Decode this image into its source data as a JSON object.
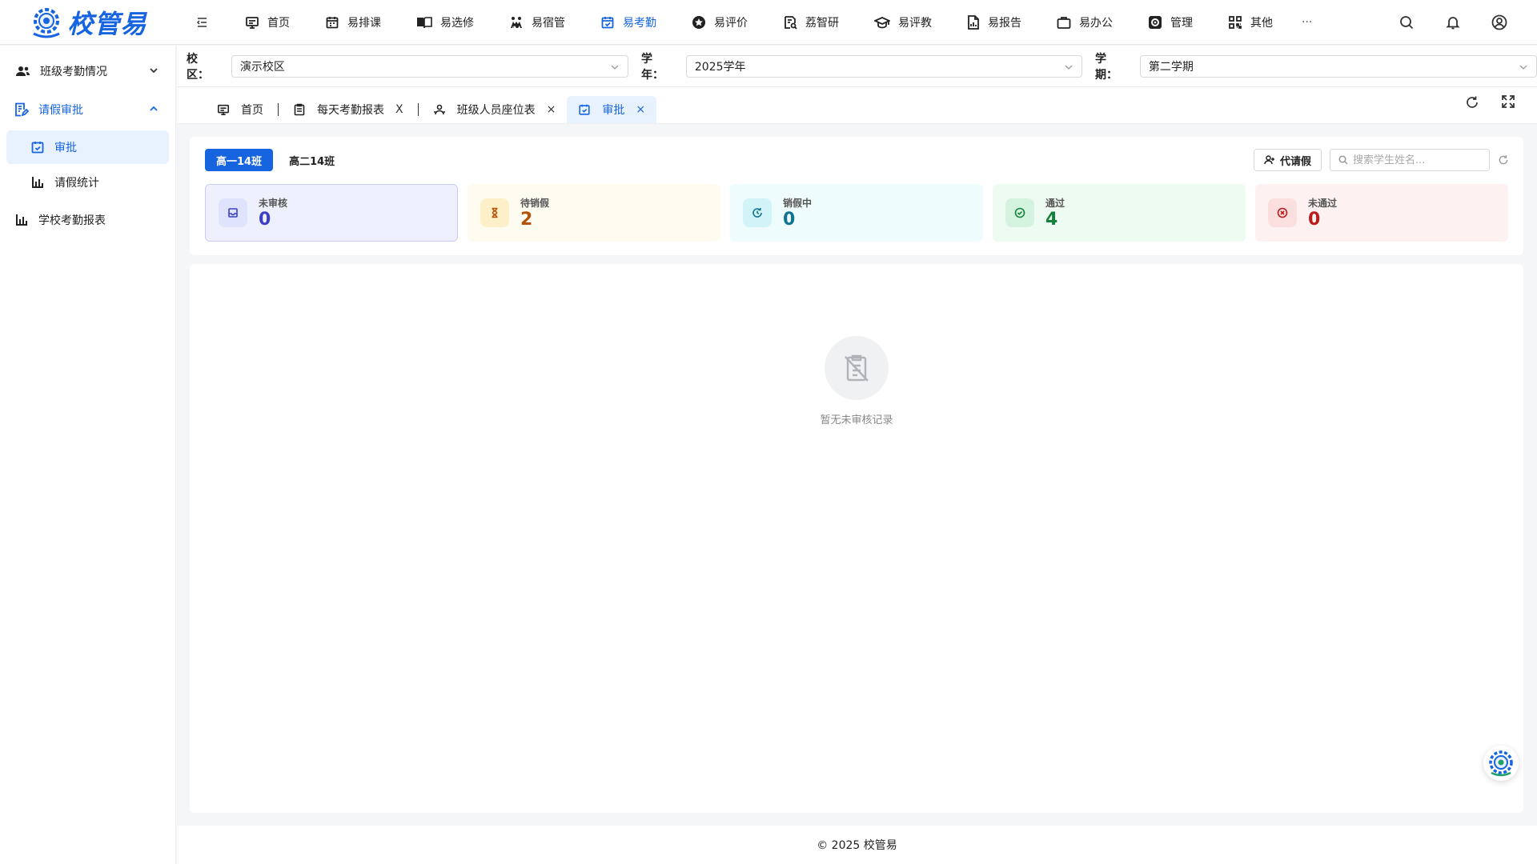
{
  "app": {
    "logo_text": "校管易"
  },
  "nav": {
    "items": [
      {
        "label": "首页",
        "icon": "monitor-icon",
        "active": false
      },
      {
        "label": "易排课",
        "icon": "calendar-icon",
        "active": false
      },
      {
        "label": "易选修",
        "icon": "book-icon",
        "active": false
      },
      {
        "label": "易宿管",
        "icon": "bunk-bed-icon",
        "active": false
      },
      {
        "label": "易考勤",
        "icon": "calendar-check-icon",
        "active": true
      },
      {
        "label": "易评价",
        "icon": "star-badge-icon",
        "active": false
      },
      {
        "label": "荔智研",
        "icon": "research-icon",
        "active": false
      },
      {
        "label": "易评教",
        "icon": "graduation-cap-icon",
        "active": false
      },
      {
        "label": "易报告",
        "icon": "report-icon",
        "active": false
      },
      {
        "label": "易办公",
        "icon": "briefcase-icon",
        "active": false
      },
      {
        "label": "管理",
        "icon": "settings-icon",
        "active": false
      },
      {
        "label": "其他",
        "icon": "grid-icon",
        "active": false
      }
    ],
    "more": "···"
  },
  "sidebar": {
    "items": [
      {
        "label": "班级考勤情况",
        "icon": "users-icon"
      },
      {
        "label": "请假审批",
        "icon": "document-edit-icon"
      },
      {
        "label": "审批",
        "icon": "calendar-check-icon"
      },
      {
        "label": "请假统计",
        "icon": "bar-chart-icon"
      },
      {
        "label": "学校考勤报表",
        "icon": "bar-chart-icon"
      }
    ]
  },
  "filters": {
    "campus_label": "校区：",
    "campus_value": "演示校区",
    "year_label": "学年：",
    "year_value": "2025学年",
    "term_label": "学期：",
    "term_value": "第二学期"
  },
  "tabs": [
    {
      "label": "首页",
      "closable": false,
      "active": false
    },
    {
      "label": "每天考勤报表",
      "closable": true,
      "active": false
    },
    {
      "label": "班级人员座位表",
      "closable": true,
      "active": false
    },
    {
      "label": "审批",
      "closable": true,
      "active": true
    }
  ],
  "classes": {
    "items": [
      "高一14班",
      "高二14班"
    ],
    "selected": "高一14班"
  },
  "actions": {
    "proxy_leave": "代请假",
    "search_placeholder": "搜索学生姓名..."
  },
  "stats": [
    {
      "label": "未审核",
      "value": "0",
      "color": "#3b3fc7",
      "bg": "#eef1fd",
      "icon_bg": "#dfe3fb"
    },
    {
      "label": "待销假",
      "value": "2",
      "color": "#b45309",
      "bg": "#fefbf0",
      "icon_bg": "#fdf0c8"
    },
    {
      "label": "销假中",
      "value": "0",
      "color": "#0e7490",
      "bg": "#effcfd",
      "icon_bg": "#d2f3f7"
    },
    {
      "label": "通过",
      "value": "4",
      "color": "#15803d",
      "bg": "#eefbf2",
      "icon_bg": "#d4f3de"
    },
    {
      "label": "未通过",
      "value": "0",
      "color": "#b91c1c",
      "bg": "#fdf1f1",
      "icon_bg": "#fbdede"
    }
  ],
  "empty": {
    "text": "暂无未审核记录"
  },
  "footer": {
    "text": "© 2025 校管易"
  }
}
